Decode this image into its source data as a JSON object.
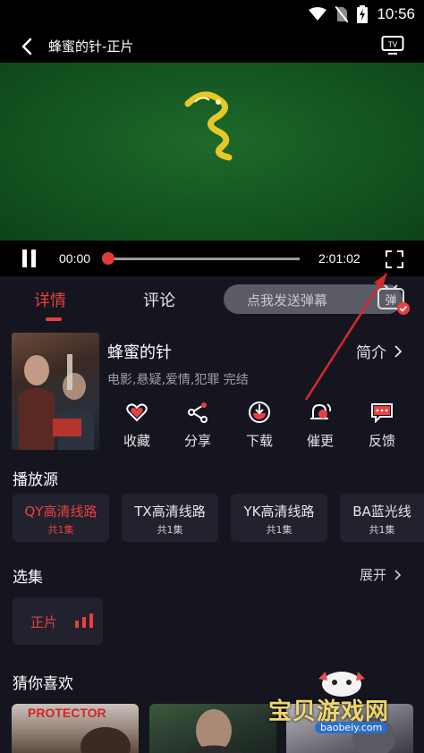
{
  "status_bar": {
    "time": "10:56"
  },
  "header": {
    "title": "蜂蜜的针-正片"
  },
  "player": {
    "current_time": "00:00",
    "total_time": "2:01:02",
    "progress": 0.0
  },
  "tabs": [
    {
      "label": "详情",
      "active": true
    },
    {
      "label": "评论",
      "active": false
    }
  ],
  "danmaku": {
    "placeholder": "点我发送弹幕",
    "toggle_label": "弹"
  },
  "movie": {
    "title": "蜂蜜的针",
    "intro_label": "简介",
    "tags": "电影,悬疑,爱情,犯罪 完结"
  },
  "actions": [
    {
      "label": "收藏",
      "icon": "heart-icon"
    },
    {
      "label": "分享",
      "icon": "share-icon"
    },
    {
      "label": "下载",
      "icon": "download-icon"
    },
    {
      "label": "催更",
      "icon": "bell-icon"
    },
    {
      "label": "反馈",
      "icon": "feedback-icon"
    }
  ],
  "sources": {
    "title": "播放源",
    "items": [
      {
        "name": "QY高清线路",
        "count": "共1集",
        "active": true
      },
      {
        "name": "TX高清线路",
        "count": "共1集",
        "active": false
      },
      {
        "name": "YK高清线路",
        "count": "共1集",
        "active": false
      },
      {
        "name": "BA蓝光线",
        "count": "共1集",
        "active": false
      }
    ]
  },
  "episodes": {
    "title": "选集",
    "expand_label": "展开",
    "items": [
      {
        "label": "正片"
      }
    ]
  },
  "recommend": {
    "title": "猜你喜欢",
    "items": [
      {
        "title": "PROTECTOR"
      },
      {
        "title": ""
      },
      {
        "title": ""
      }
    ]
  },
  "watermark": {
    "text": "宝贝游戏网",
    "url": "baobeiy.com"
  },
  "colors": {
    "accent": "#e84040",
    "background": "#15151f",
    "card": "#22222e"
  }
}
